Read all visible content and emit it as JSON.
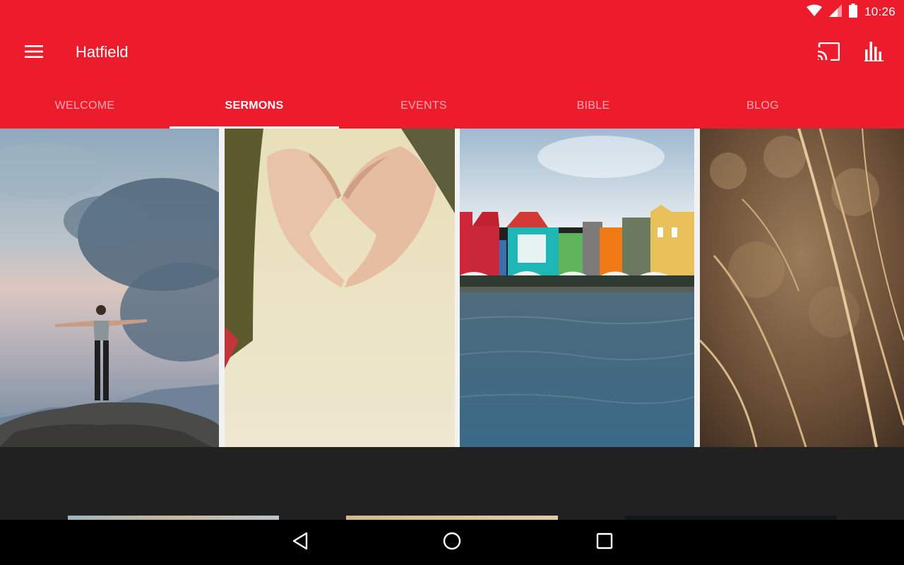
{
  "status_bar": {
    "time": "10:26",
    "icons": [
      "wifi-icon",
      "cell-signal-icon",
      "battery-icon"
    ]
  },
  "app_bar": {
    "title": "Hatfield",
    "icons": [
      "menu-icon",
      "cast-icon",
      "stats-icon"
    ]
  },
  "tabs": [
    {
      "label": "WELCOME",
      "active": false
    },
    {
      "label": "SERMONS",
      "active": true
    },
    {
      "label": "EVENTS",
      "active": false
    },
    {
      "label": "BIBLE",
      "active": false
    },
    {
      "label": "BLOG",
      "active": false
    }
  ],
  "cards": [
    {
      "subject": "person on mountain top with arms outstretched"
    },
    {
      "subject": "hands forming heart shape"
    },
    {
      "subject": "colorful waterfront buildings"
    },
    {
      "subject": "golden dry grass"
    }
  ],
  "nav_bar": {
    "icons": [
      "back-icon",
      "home-icon",
      "recents-icon"
    ]
  },
  "colors": {
    "primary": "#ec1c2c",
    "background": "#212121",
    "nav_bar": "#000000"
  }
}
